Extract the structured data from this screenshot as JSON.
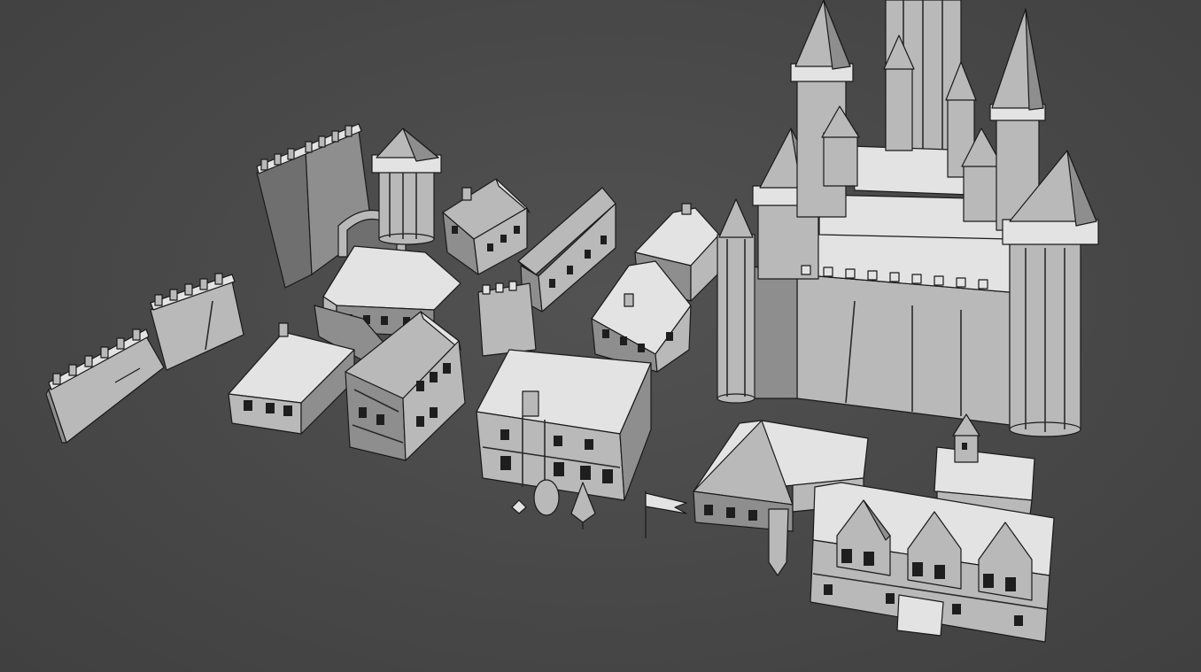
{
  "scene": {
    "background_color": "#4a4a4a",
    "surface_light": "#e3e3e3",
    "surface_mid": "#b9b9b9",
    "surface_dark": "#8e8e8e",
    "edge_color": "#1a1a1a",
    "objects": [
      "castle",
      "castle-wall-segment",
      "watch-tower",
      "gatehouse-wall",
      "small-house",
      "tudor-house",
      "long-house",
      "manor-house",
      "chapel",
      "banner-flag",
      "tree",
      "bush"
    ]
  }
}
